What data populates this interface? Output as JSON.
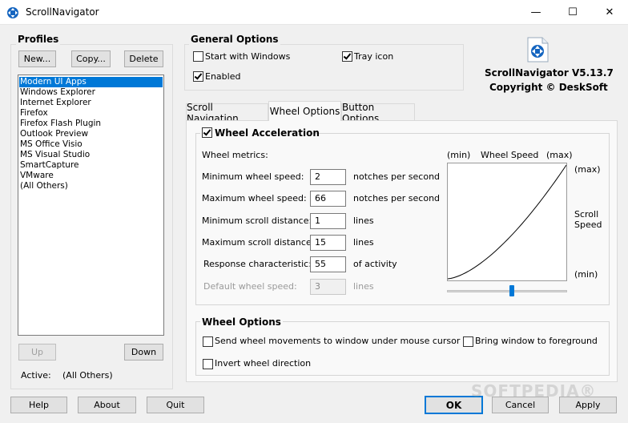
{
  "window": {
    "title": "ScrollNavigator",
    "minimize_glyph": "—",
    "maximize_glyph": "☐",
    "close_glyph": "✕"
  },
  "profiles": {
    "heading": "Profiles",
    "new_label": "New...",
    "copy_label": "Copy...",
    "delete_label": "Delete",
    "items": [
      "Modern UI Apps",
      "Windows Explorer",
      "Internet Explorer",
      "Firefox",
      "Firefox Flash Plugin",
      "Outlook Preview",
      "MS Office Visio",
      "MS Visual Studio",
      "SmartCapture",
      "VMware",
      "(All Others)"
    ],
    "selected_index": 0,
    "up_label": "Up",
    "down_label": "Down",
    "active_label": "Active:",
    "active_value": "(All Others)"
  },
  "general": {
    "heading": "General Options",
    "start_with_windows": {
      "label": "Start with Windows",
      "checked": false
    },
    "tray_icon": {
      "label": "Tray icon",
      "checked": true
    },
    "enabled": {
      "label": "Enabled",
      "checked": true
    }
  },
  "about": {
    "version": "ScrollNavigator V5.13.7",
    "copyright": "Copyright © DeskSoft"
  },
  "tabs": {
    "scroll_navigation": "Scroll Navigation",
    "wheel_options": "Wheel Options",
    "button_options": "Button Options",
    "active": "wheel_options"
  },
  "wheel_accel": {
    "heading": "Wheel Acceleration",
    "checked": true,
    "metrics_label": "Wheel metrics:",
    "rows": [
      {
        "label": "Minimum wheel speed:",
        "value": "2",
        "unit": "notches per second",
        "disabled": false
      },
      {
        "label": "Maximum wheel speed:",
        "value": "66",
        "unit": "notches per second",
        "disabled": false
      },
      {
        "label": "Minimum scroll distance:",
        "value": "1",
        "unit": "lines",
        "disabled": false
      },
      {
        "label": "Maximum scroll distance:",
        "value": "15",
        "unit": "lines",
        "disabled": false
      },
      {
        "label": "Response characteristic:",
        "value": "55",
        "unit": "of activity",
        "disabled": false
      },
      {
        "label": "Default wheel speed:",
        "value": "3",
        "unit": "lines",
        "disabled": true
      }
    ],
    "graph": {
      "x_min": "(min)",
      "x_title": "Wheel Speed",
      "x_max": "(max)",
      "y_max": "(max)",
      "y_title_1": "Scroll",
      "y_title_2": "Speed",
      "y_min": "(min)",
      "slider_fraction": 0.54
    }
  },
  "wheel_options": {
    "heading": "Wheel Options",
    "send_under_cursor": {
      "label": "Send wheel movements to window under mouse cursor",
      "checked": false
    },
    "bring_to_foreground": {
      "label": "Bring window to foreground",
      "checked": false
    },
    "invert_direction": {
      "label": "Invert wheel direction",
      "checked": false
    }
  },
  "footer": {
    "help": "Help",
    "about": "About",
    "quit": "Quit",
    "ok": "OK",
    "cancel": "Cancel",
    "apply": "Apply",
    "watermark": "SOFTPEDIA®"
  },
  "colors": {
    "selection": "#0078d7",
    "app_icon": "#1565c0"
  }
}
